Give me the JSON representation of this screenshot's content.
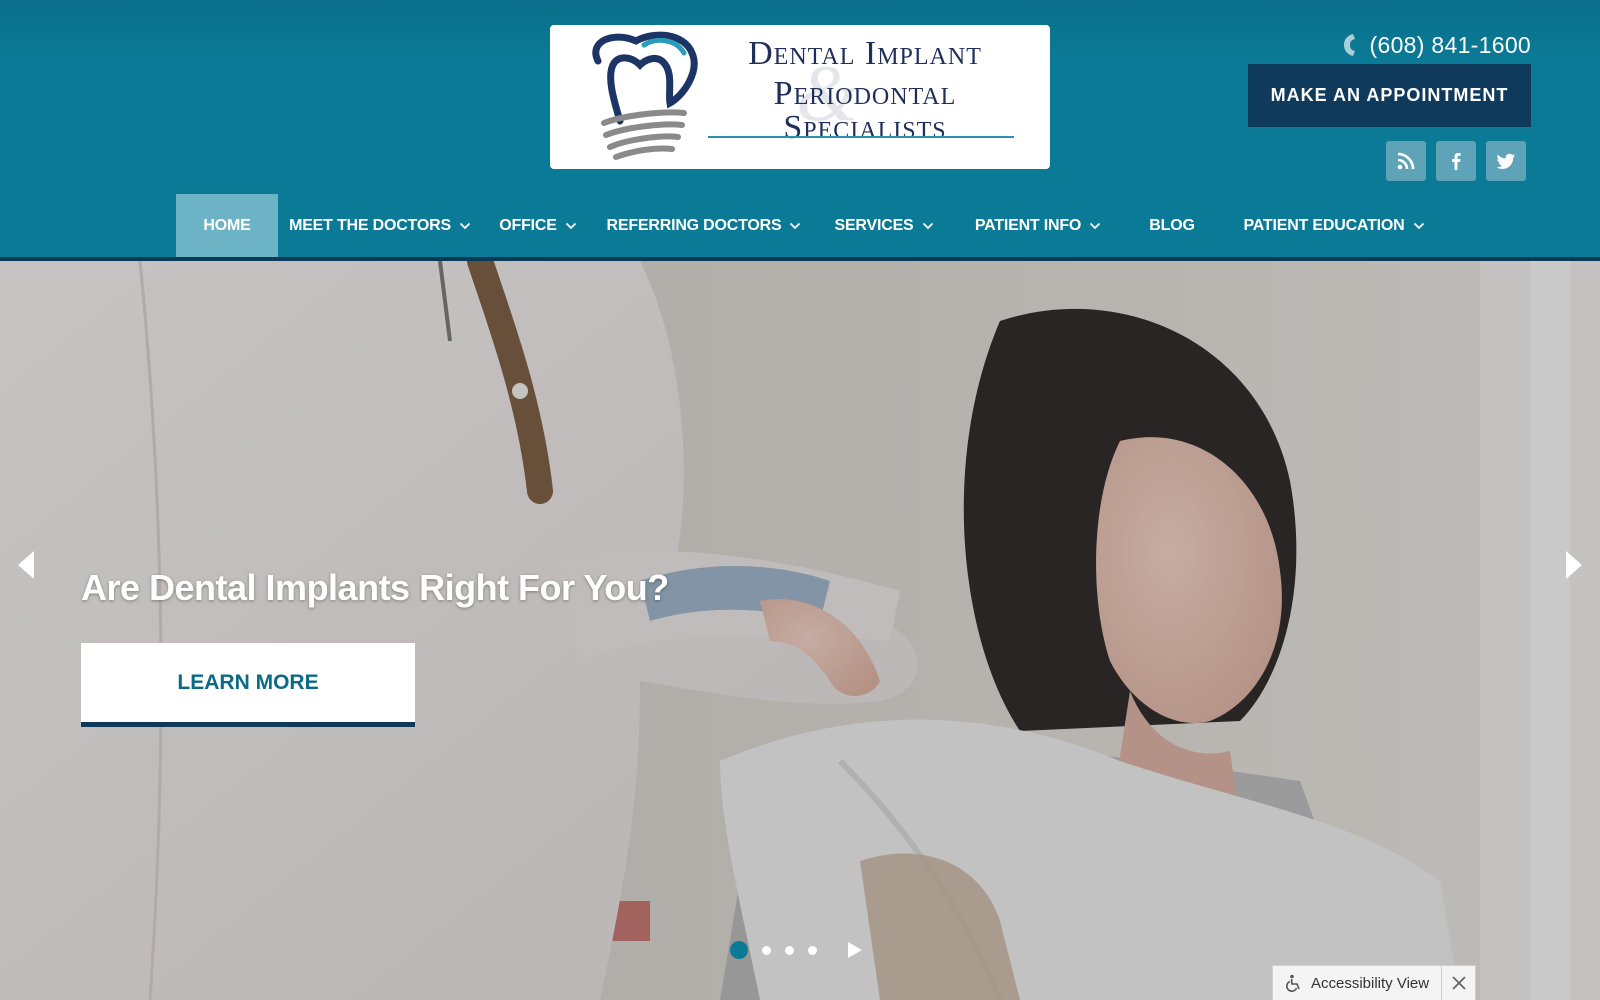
{
  "brand": {
    "logo_line1": "Dental Implant",
    "logo_line2": "Periodontal",
    "logo_line3": "Specialists",
    "logo_amp": "&"
  },
  "header": {
    "phone": "(608) 841-1600",
    "appointment_label": "MAKE AN APPOINTMENT",
    "social": [
      {
        "name": "rss-icon"
      },
      {
        "name": "facebook-icon"
      },
      {
        "name": "twitter-icon"
      }
    ]
  },
  "nav": {
    "items": [
      {
        "label": "HOME",
        "active": true,
        "dropdown": false
      },
      {
        "label": "MEET THE DOCTORS",
        "active": false,
        "dropdown": true
      },
      {
        "label": "OFFICE",
        "active": false,
        "dropdown": true
      },
      {
        "label": "REFERRING DOCTORS",
        "active": false,
        "dropdown": true
      },
      {
        "label": "SERVICES",
        "active": false,
        "dropdown": true
      },
      {
        "label": "PATIENT INFO",
        "active": false,
        "dropdown": true
      },
      {
        "label": "BLOG",
        "active": false,
        "dropdown": false
      },
      {
        "label": "PATIENT EDUCATION",
        "active": false,
        "dropdown": true
      }
    ]
  },
  "hero": {
    "title": "Are Dental Implants Right For You?",
    "button_label": "LEARN MORE",
    "slide_count": 4,
    "active_slide": 1
  },
  "accessibility": {
    "label": "Accessibility View"
  },
  "colors": {
    "header_teal": "#0b7a96",
    "navy": "#0f3a5c",
    "nav_active": "#6cb3c6",
    "social_bg": "#5fa3b8"
  }
}
